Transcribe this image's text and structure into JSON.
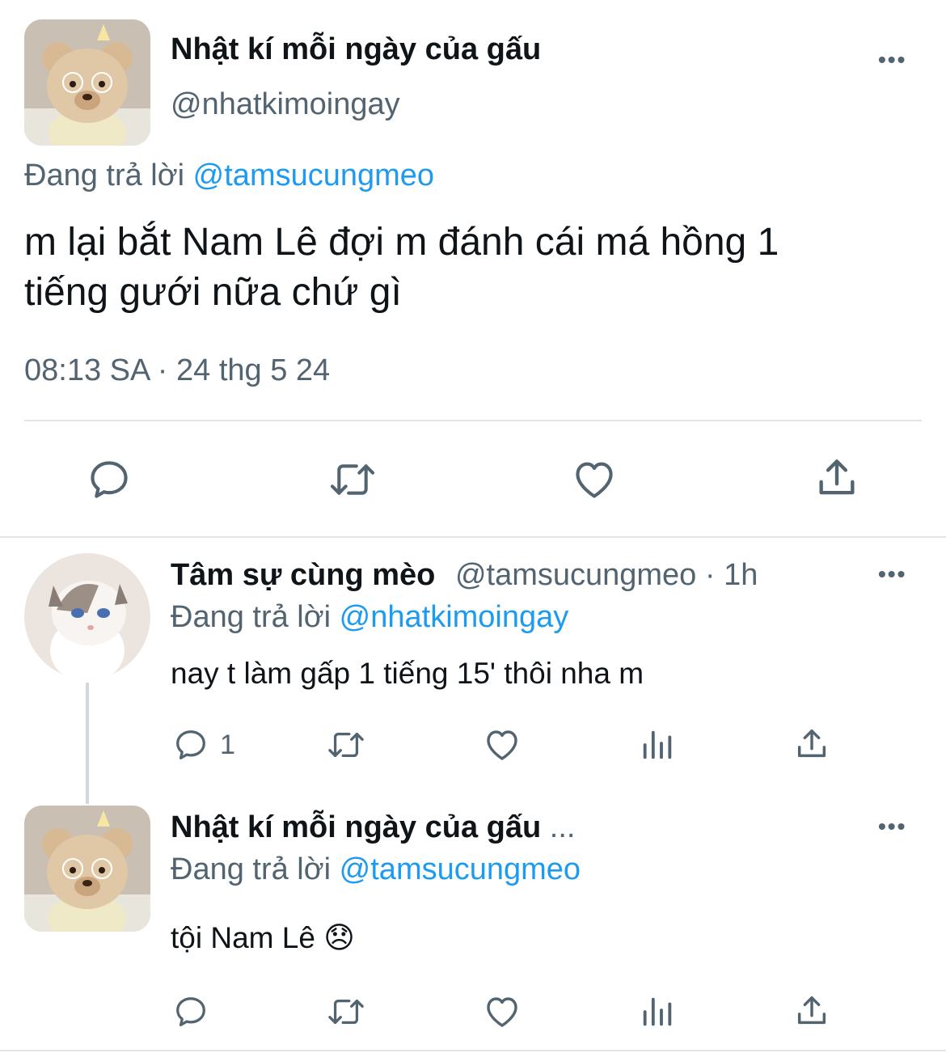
{
  "main_tweet": {
    "display_name": "Nhật kí mỗi ngày của gấu",
    "handle": "@nhatkimoingay",
    "reply_prefix": "Đang trả lời",
    "reply_to": "@tamsucungmeo",
    "text_line1": "m lại bắt Nam Lê đợi m đánh cái má hồng 1",
    "text_line2": "tiếng gưới nữa chứ gì",
    "timestamp": "08:13 SA · 24 thg 5 24",
    "more_label": "•••"
  },
  "reply1": {
    "display_name": "Tâm sự cùng mèo",
    "handle": "@tamsucungmeo",
    "separator": "·",
    "time": "1h",
    "reply_prefix": "Đang trả lời",
    "reply_to": "@nhatkimoingay",
    "text": "nay t làm gấp 1 tiếng 15' thôi nha m",
    "reply_count": "1",
    "more_label": "•••"
  },
  "reply2": {
    "display_name": "Nhật kí mỗi ngày của gấu",
    "name_ellipsis": "...",
    "reply_prefix": "Đang trả lời",
    "reply_to": "@tamsucungmeo",
    "text": "tội Nam Lê",
    "emoji": "😞",
    "more_label": "•••"
  },
  "icons": [
    "reply-icon",
    "retweet-icon",
    "like-icon",
    "share-icon",
    "views-icon",
    "more-icon"
  ],
  "colors": {
    "accent": "#1d9bf0",
    "muted": "#536471",
    "text": "#0f1419",
    "divider": "#e1e5e9"
  }
}
